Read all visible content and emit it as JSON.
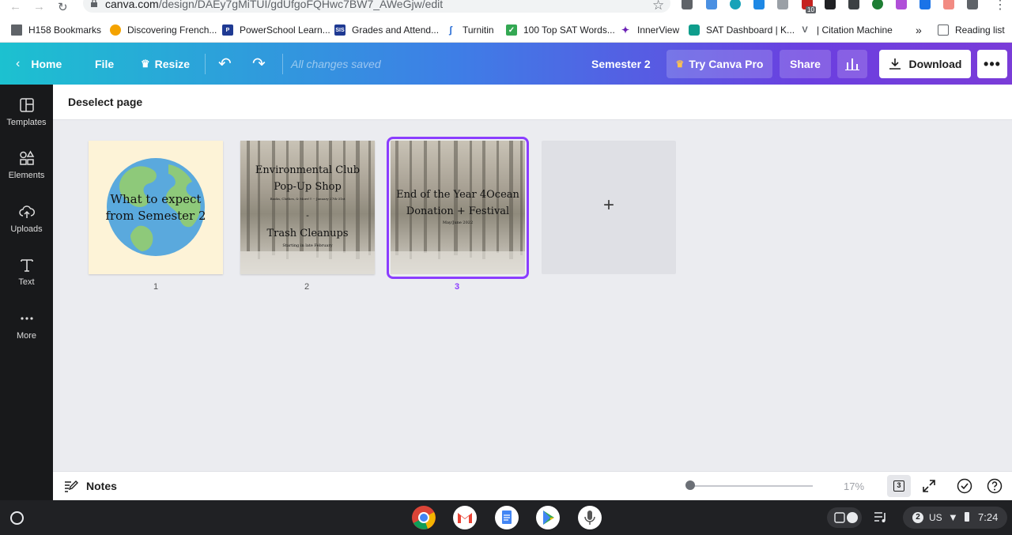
{
  "browser": {
    "url_host": "canva.com",
    "url_path": "/design/DAEy7gMiTUI/gdUfgoFQHwc7BW7_AWeGjw/edit",
    "extension_badge": "10"
  },
  "bookmarks": [
    {
      "label": "H158 Bookmarks",
      "icon": "folder-icon",
      "color": "#5f6368"
    },
    {
      "label": "Discovering French...",
      "icon": "circle-icon",
      "color": "#f4a300"
    },
    {
      "label": "PowerSchool Learn...",
      "icon": "powerschool-icon",
      "color": "#1f3a93"
    },
    {
      "label": "Grades and Attend...",
      "icon": "sis-icon",
      "color": "#1f3a93"
    },
    {
      "label": "Turnitin",
      "icon": "turnitin-icon",
      "color": "#2b6fd6"
    },
    {
      "label": "100 Top SAT Words...",
      "icon": "check-icon",
      "color": "#34a853"
    },
    {
      "label": "InnerView",
      "icon": "innerview-icon",
      "color": "#6a1fb5"
    },
    {
      "label": "SAT Dashboard | K...",
      "icon": "shield-icon",
      "color": "#0f9d8c"
    },
    {
      "label": "| Citation Machine",
      "icon": "citation-icon",
      "color": "#5f6368"
    }
  ],
  "bookmarks_overflow": "»",
  "reading_list": "Reading list",
  "header": {
    "home": "Home",
    "file": "File",
    "resize": "Resize",
    "saved_status": "All changes saved",
    "doc_title": "Semester 2",
    "try_pro": "Try Canva Pro",
    "share": "Share",
    "download": "Download",
    "more": "•••"
  },
  "sidebar": {
    "items": [
      {
        "label": "Templates",
        "icon": "templates-icon"
      },
      {
        "label": "Elements",
        "icon": "elements-icon"
      },
      {
        "label": "Uploads",
        "icon": "uploads-icon"
      },
      {
        "label": "Text",
        "icon": "text-icon"
      },
      {
        "label": "More",
        "icon": "more-icon"
      }
    ]
  },
  "workspace": {
    "deselect": "Deselect page",
    "pages": [
      {
        "number": "1",
        "line1": "What to expect",
        "line2": "from Semester 2"
      },
      {
        "number": "2",
        "title1": "Environmental Club",
        "title2": "Pop-Up Shop",
        "sub1": "Books, Clothes, & More!!! -- January 27th-31st",
        "dash": "-",
        "title3": "Trash Cleanups",
        "sub2": "Starting in late February"
      },
      {
        "number": "3",
        "title1": "End of the Year 4Ocean",
        "title2": "Donation + Festival",
        "sub1": "May/June 2022"
      }
    ],
    "add_page": "+",
    "selected_page": 3
  },
  "bottom": {
    "notes": "Notes",
    "zoom": "17%",
    "page_count": "3",
    "zoom_level": 0.17
  },
  "shelf": {
    "badge": "2",
    "locale": "US",
    "time": "7:24"
  },
  "colors": {
    "accent_purple": "#8b3dff",
    "gradient_start": "#1cc1d0",
    "gradient_end": "#7a3cd8"
  }
}
